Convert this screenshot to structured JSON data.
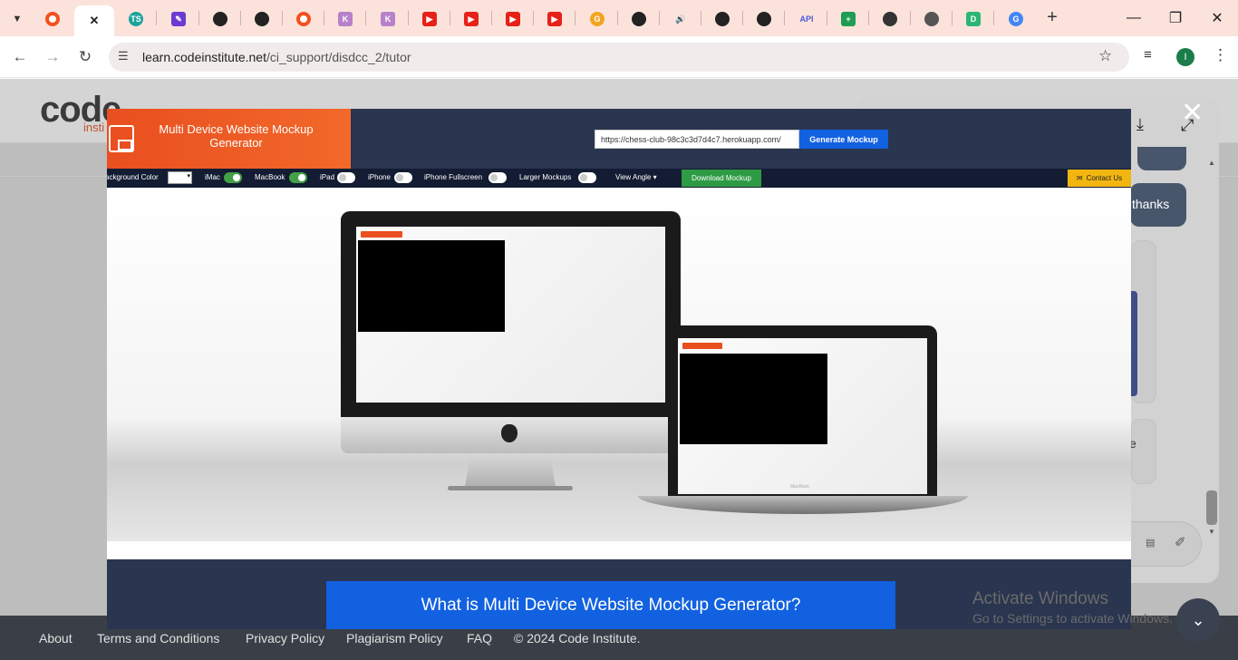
{
  "browser": {
    "tabs": [
      {
        "icon": "circle-ring-icon",
        "color": "#f4501e",
        "glyph": ""
      },
      {
        "icon": "close-icon",
        "color": "#222222",
        "glyph": "✕",
        "active": true
      },
      {
        "icon": "ts-icon",
        "color": "#1ba39c",
        "glyph": "TS"
      },
      {
        "icon": "pen-icon",
        "color": "#6c3bd1",
        "glyph": "✎"
      },
      {
        "icon": "github-icon",
        "color": "#222222",
        "glyph": "●"
      },
      {
        "icon": "github-icon",
        "color": "#222222",
        "glyph": "●"
      },
      {
        "icon": "circle-ring-icon",
        "color": "#f4501e",
        "glyph": ""
      },
      {
        "icon": "k-icon",
        "color": "#b681c9",
        "glyph": "K"
      },
      {
        "icon": "k-icon",
        "color": "#b681c9",
        "glyph": "K"
      },
      {
        "icon": "youtube-icon",
        "color": "#e62117",
        "glyph": "▶"
      },
      {
        "icon": "youtube-icon",
        "color": "#e62117",
        "glyph": "▶"
      },
      {
        "icon": "youtube-icon",
        "color": "#e62117",
        "glyph": "▶"
      },
      {
        "icon": "youtube-icon",
        "color": "#e62117",
        "glyph": "▶"
      },
      {
        "icon": "swirl-icon",
        "color": "#f4a321",
        "glyph": "G"
      },
      {
        "icon": "github-icon",
        "color": "#222222",
        "glyph": "●"
      },
      {
        "icon": "speaker-icon",
        "color": "#333333",
        "glyph": "🔊"
      },
      {
        "icon": "github-icon",
        "color": "#222222",
        "glyph": "●"
      },
      {
        "icon": "github-icon",
        "color": "#222222",
        "glyph": "●"
      },
      {
        "icon": "api-icon",
        "color": "#4b5bd6",
        "glyph": "API"
      },
      {
        "icon": "sheets-icon",
        "color": "#1e9d53",
        "glyph": "+"
      },
      {
        "icon": "openai-icon",
        "color": "#333333",
        "glyph": "⚙"
      },
      {
        "icon": "globe-icon",
        "color": "#555555",
        "glyph": "◎"
      },
      {
        "icon": "d-icon",
        "color": "#2bb673",
        "glyph": "D"
      },
      {
        "icon": "google-icon",
        "color": "#4285f4",
        "glyph": "G"
      }
    ],
    "new_tab": "+",
    "url_host": "learn.codeinstitute.net",
    "url_path": "/ci_support/disdcc_2/tutor",
    "profile_initial": "I"
  },
  "page": {
    "logo": "code",
    "logo_sub": "insti",
    "chat_thanks": "thanks",
    "chat_card_text": "e",
    "footer_links": [
      "About",
      "Terms and Conditions",
      "Privacy Policy",
      "Plagiarism Policy",
      "FAQ",
      "© 2024 Code Institute."
    ]
  },
  "modal": {
    "title": "Multi Device Website Mockup Generator",
    "url_value": "https://chess-club-98c3c3d7d4c7.herokuapp.com/",
    "generate_label": "Generate Mockup",
    "options": [
      {
        "label": "ackground Color",
        "type": "color"
      },
      {
        "label": "iMac",
        "type": "toggle",
        "on": true
      },
      {
        "label": "MacBook",
        "type": "toggle",
        "on": true
      },
      {
        "label": "iPad",
        "type": "toggle",
        "on": false
      },
      {
        "label": "iPhone",
        "type": "toggle",
        "on": false
      },
      {
        "label": "iPhone Fullscreen",
        "type": "toggle",
        "on": false
      },
      {
        "label": "Larger Mockups",
        "type": "toggle",
        "on": false
      },
      {
        "label": "View Angle",
        "type": "dropdown"
      }
    ],
    "download_label": "Download Mockup",
    "contact_label": "Contact Us",
    "question_label": "What is Multi Device Website Mockup Generator?",
    "laptop_brand": "MacBook"
  },
  "os_overlay": {
    "activate_title": "Activate Windows",
    "activate_sub": "Go to Settings to activate Windows."
  }
}
